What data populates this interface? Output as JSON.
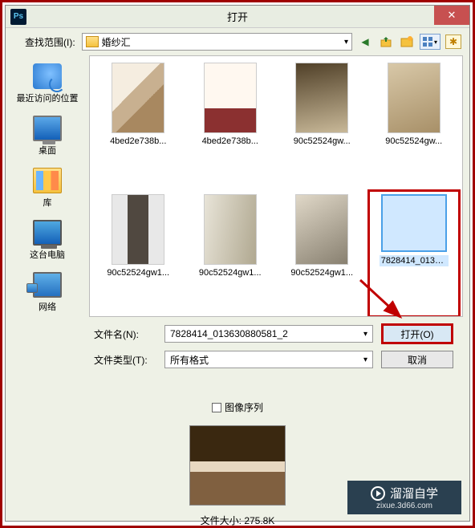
{
  "titlebar": {
    "title": "打开",
    "icon": "Ps"
  },
  "toolbar": {
    "lookin_label": "查找范围(I):",
    "folder_name": "婚纱汇"
  },
  "places": [
    {
      "label": "最近访问的位置",
      "icon": "recent-ic"
    },
    {
      "label": "桌面",
      "icon": "desktop-ic"
    },
    {
      "label": "库",
      "icon": "lib-ic"
    },
    {
      "label": "这台电脑",
      "icon": "pc-ic"
    },
    {
      "label": "网络",
      "icon": "net-ic"
    }
  ],
  "files": [
    {
      "name": "4bed2e738b...",
      "thumb": "t1"
    },
    {
      "name": "4bed2e738b...",
      "thumb": "t2"
    },
    {
      "name": "90c52524gw...",
      "thumb": "t3"
    },
    {
      "name": "90c52524gw...",
      "thumb": "t4"
    },
    {
      "name": "90c52524gw1...",
      "thumb": "t5"
    },
    {
      "name": "90c52524gw1...",
      "thumb": "t6"
    },
    {
      "name": "90c52524gw1...",
      "thumb": "t7"
    },
    {
      "name": "7828414_013630880581_2",
      "thumb": "t8",
      "selected": true
    }
  ],
  "form": {
    "filename_label": "文件名(N):",
    "filename_value": "7828414_013630880581_2",
    "filetype_label": "文件类型(T):",
    "filetype_value": "所有格式",
    "open_btn": "打开(O)",
    "cancel_btn": "取消"
  },
  "preview": {
    "sequence_label": "图像序列",
    "filesize_label": "文件大小:",
    "filesize_value": "275.8K"
  },
  "watermark": {
    "brand": "溜溜自学",
    "url": "zixue.3d66.com"
  }
}
